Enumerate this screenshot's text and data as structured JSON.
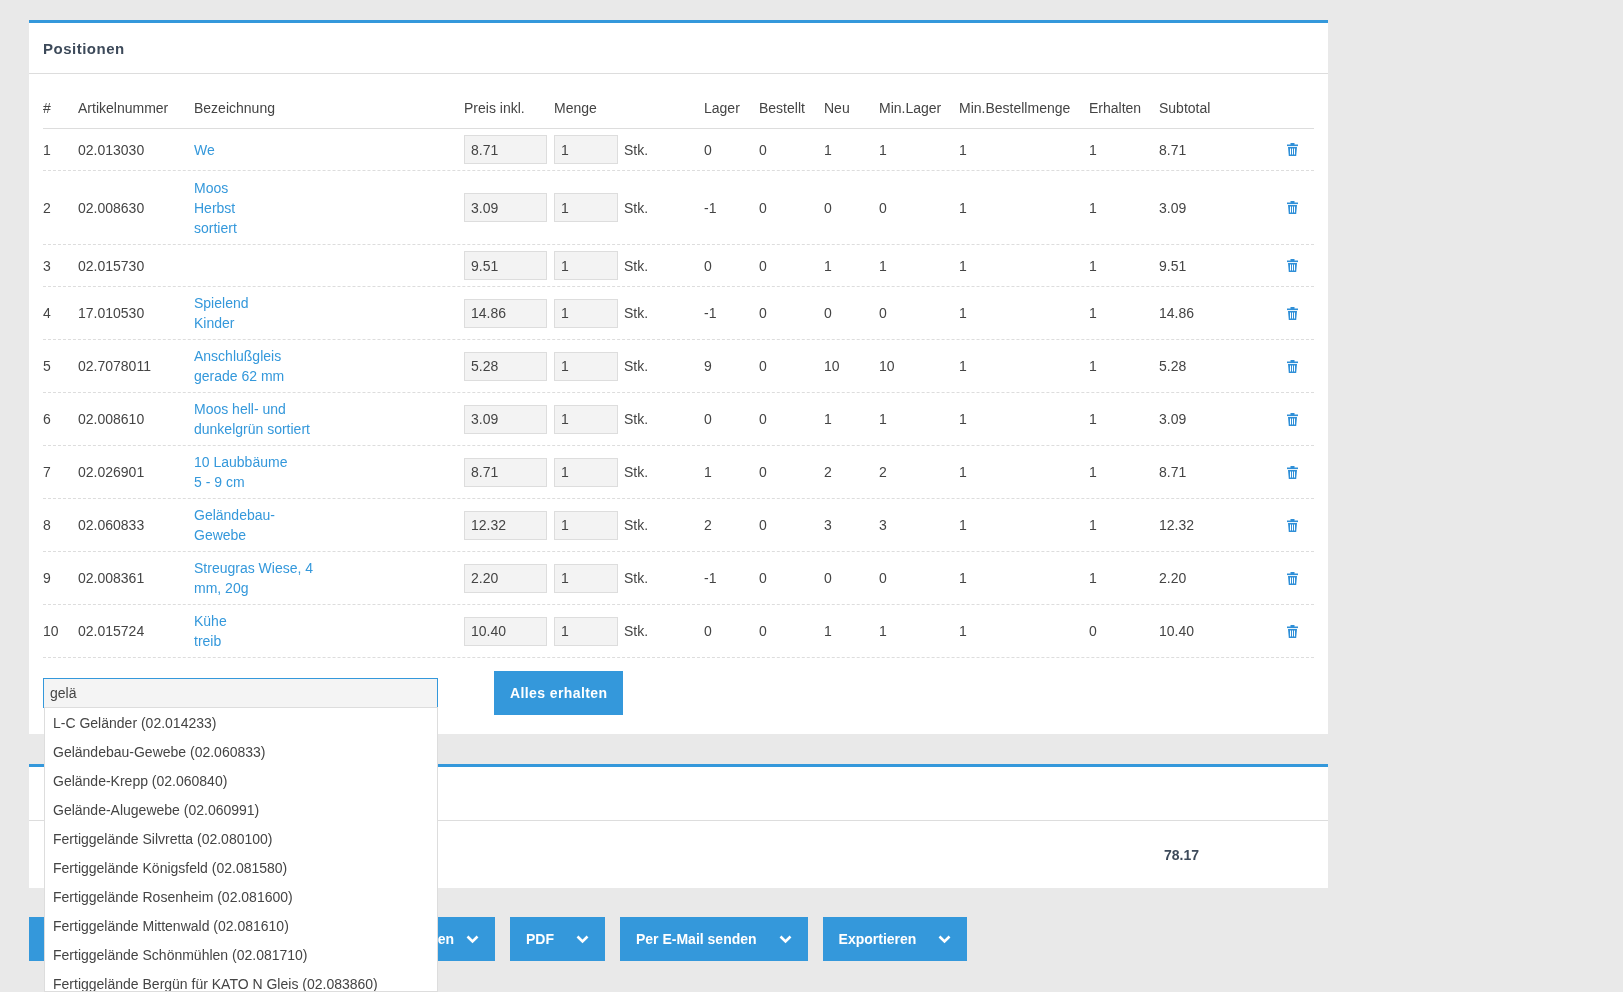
{
  "positions": {
    "title": "Positionen",
    "columns": [
      "#",
      "Artikelnummer",
      "Bezeichnung",
      "Preis inkl.",
      "Menge",
      "Lager",
      "Bestellt",
      "Neu",
      "Min.Lager",
      "Min.Bestellmenge",
      "Erhalten",
      "Subtotal"
    ],
    "rows": [
      {
        "index": "1",
        "article": "02.013030",
        "name": "We",
        "price": "8.71",
        "quantity": "1",
        "unit": "Stk.",
        "stock": "0",
        "ordered": "0",
        "new": "1",
        "min_stock": "1",
        "min_order": "1",
        "received": "1",
        "subtotal": "8.71"
      },
      {
        "index": "2",
        "article": "02.008630",
        "name": "Moos\nHerbst\nsortiert",
        "price": "3.09",
        "quantity": "1",
        "unit": "Stk.",
        "stock": "-1",
        "ordered": "0",
        "new": "0",
        "min_stock": "0",
        "min_order": "1",
        "received": "1",
        "subtotal": "3.09"
      },
      {
        "index": "3",
        "article": "02.015730",
        "price": "9.51",
        "quantity": "1",
        "unit": "Stk.",
        "stock": "0",
        "ordered": "0",
        "new": "1",
        "min_stock": "1",
        "min_order": "1",
        "received": "1",
        "subtotal": "9.51"
      },
      {
        "index": "4",
        "article": "17.010530",
        "name": "Spielend\nKinder",
        "price": "14.86",
        "quantity": "1",
        "unit": "Stk.",
        "stock": "-1",
        "ordered": "0",
        "new": "0",
        "min_stock": "0",
        "min_order": "1",
        "received": "1",
        "subtotal": "14.86"
      },
      {
        "index": "5",
        "article": "02.7078011",
        "name": "Anschlußgleis\ngerade 62 mm",
        "price": "5.28",
        "quantity": "1",
        "unit": "Stk.",
        "stock": "9",
        "ordered": "0",
        "new": "10",
        "min_stock": "10",
        "min_order": "1",
        "received": "1",
        "subtotal": "5.28"
      },
      {
        "index": "6",
        "article": "02.008610",
        "name": "Moos hell- und\ndunkelgrün sortiert",
        "price": "3.09",
        "quantity": "1",
        "unit": "Stk.",
        "stock": "0",
        "ordered": "0",
        "new": "1",
        "min_stock": "1",
        "min_order": "1",
        "received": "1",
        "subtotal": "3.09"
      },
      {
        "index": "7",
        "article": "02.026901",
        "name": "10 Laubbäume\n5 - 9 cm",
        "price": "8.71",
        "quantity": "1",
        "unit": "Stk.",
        "stock": "1",
        "ordered": "0",
        "new": "2",
        "min_stock": "2",
        "min_order": "1",
        "received": "1",
        "subtotal": "8.71"
      },
      {
        "index": "8",
        "article": "02.060833",
        "name": "Geländebau-\nGewebe",
        "price": "12.32",
        "quantity": "1",
        "unit": "Stk.",
        "stock": "2",
        "ordered": "0",
        "new": "3",
        "min_stock": "3",
        "min_order": "1",
        "received": "1",
        "subtotal": "12.32"
      },
      {
        "index": "9",
        "article": "02.008361",
        "name": "Streugras Wiese, 4\nmm, 20g",
        "price": "2.20",
        "quantity": "1",
        "unit": "Stk.",
        "stock": "-1",
        "ordered": "0",
        "new": "0",
        "min_stock": "0",
        "min_order": "1",
        "received": "1",
        "subtotal": "2.20"
      },
      {
        "index": "10",
        "article": "02.015724",
        "name": "Kühe\ntreib",
        "price": "10.40",
        "quantity": "1",
        "unit": "Stk.",
        "stock": "0",
        "ordered": "0",
        "new": "1",
        "min_stock": "1",
        "min_order": "1",
        "received": "0",
        "subtotal": "10.40"
      }
    ],
    "search": {
      "value": "gelä"
    },
    "receive_all_button": "Alles erhalten"
  },
  "suggestions": [
    "L-C Geländer (02.014233)",
    "Geländebau-Gewebe (02.060833)",
    "Gelände-Krepp (02.060840)",
    "Gelände-Alugewebe (02.060991)",
    "Fertiggelände Silvretta (02.080100)",
    "Fertiggelände Königsfeld (02.081580)",
    "Fertiggelände Rosenheim (02.081600)",
    "Fertiggelände Mittenwald (02.081610)",
    "Fertiggelände Schönmühlen (02.081710)",
    "Fertiggelände Bergün für KATO N Gleis (02.083860)"
  ],
  "summary": {
    "total": "78.17"
  },
  "actions": [
    {
      "label": "en"
    },
    {
      "label": "PDF"
    },
    {
      "label": "Per E-Mail senden"
    },
    {
      "label": "Exportieren"
    }
  ]
}
